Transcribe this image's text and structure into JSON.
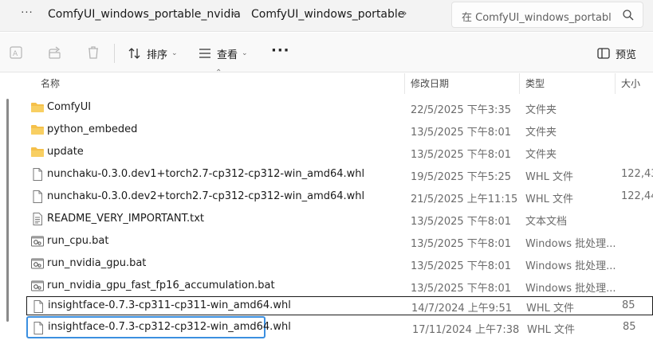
{
  "address_bar": {
    "more_label": "···",
    "breadcrumbs": [
      "ComfyUI_windows_portable_nvidia",
      "ComfyUI_windows_portable"
    ],
    "separator": "›",
    "search_placeholder": "在 ComfyUI_windows_portabl"
  },
  "toolbar": {
    "sort_label": "排序",
    "view_label": "查看",
    "more_label": "···",
    "preview_label": "预览"
  },
  "columns": {
    "name": "名称",
    "modified": "修改日期",
    "type": "类型",
    "size": "大小"
  },
  "files": [
    {
      "name": "ComfyUI",
      "modified": "22/5/2025 下午3:35",
      "type": "文件夹",
      "size": "",
      "icon": "folder-icon"
    },
    {
      "name": "python_embeded",
      "modified": "13/5/2025 下午8:01",
      "type": "文件夹",
      "size": "",
      "icon": "folder-icon"
    },
    {
      "name": "update",
      "modified": "13/5/2025 下午8:01",
      "type": "文件夹",
      "size": "",
      "icon": "folder-icon"
    },
    {
      "name": "nunchaku-0.3.0.dev1+torch2.7-cp312-cp312-win_amd64.whl",
      "modified": "19/5/2025 下午5:25",
      "type": "WHL 文件",
      "size": "122,43",
      "icon": "file-icon"
    },
    {
      "name": "nunchaku-0.3.0.dev2+torch2.7-cp312-cp312-win_amd64.whl",
      "modified": "21/5/2025 上午11:15",
      "type": "WHL 文件",
      "size": "122,44",
      "icon": "file-icon"
    },
    {
      "name": "README_VERY_IMPORTANT.txt",
      "modified": "13/5/2025 下午8:01",
      "type": "文本文档",
      "size": "",
      "icon": "text-file-icon"
    },
    {
      "name": "run_cpu.bat",
      "modified": "13/5/2025 下午8:01",
      "type": "Windows 批处理...",
      "size": "",
      "icon": "batch-file-icon"
    },
    {
      "name": "run_nvidia_gpu.bat",
      "modified": "13/5/2025 下午8:01",
      "type": "Windows 批处理...",
      "size": "",
      "icon": "batch-file-icon"
    },
    {
      "name": "run_nvidia_gpu_fast_fp16_accumulation.bat",
      "modified": "13/5/2025 下午8:01",
      "type": "Windows 批处理...",
      "size": "",
      "icon": "batch-file-icon"
    },
    {
      "name": "insightface-0.7.3-cp311-cp311-win_amd64.whl",
      "modified": "14/7/2024 上午9:51",
      "type": "WHL 文件",
      "size": "85",
      "icon": "file-icon"
    },
    {
      "name": "insightface-0.7.3-cp312-cp312-win_amd64.whl",
      "modified": "17/11/2024 上午7:38",
      "type": "WHL 文件",
      "size": "85",
      "icon": "file-icon"
    }
  ],
  "colors": {
    "folder": "#f5c04a",
    "focus_border": "#3b8fe0"
  }
}
